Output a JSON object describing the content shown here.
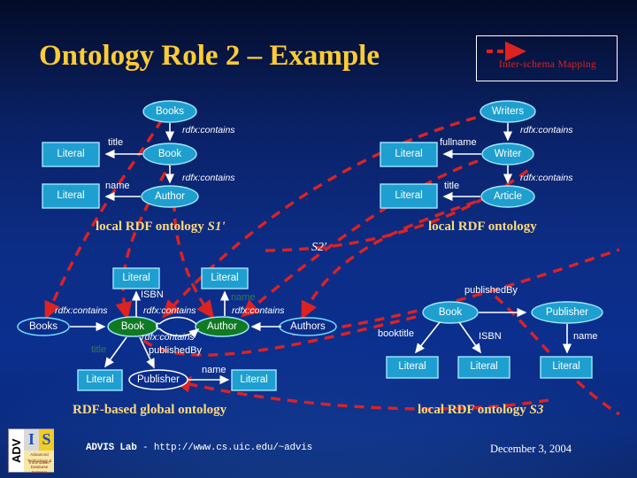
{
  "slide": {
    "title": "Ontology Role 2 – Example",
    "background_top": "#030b28",
    "background_mid": "#0c2d86",
    "title_color": "#ffcc33"
  },
  "legend": {
    "label": "Inter-schema Mapping",
    "arrow_color": "#dd2222",
    "border_color": "#ffffff"
  },
  "captions": {
    "s1": "local RDF ontology ",
    "s1_italic": "S1'",
    "s2_prefix": "local RDF ontology",
    "s2_italic": "S2'",
    "global": "RDF-based global ontology",
    "s3": "local RDF ontology ",
    "s3_italic": "S3"
  },
  "ontology_s1": {
    "nodes": [
      {
        "id": "books",
        "label": "Books",
        "shape": "ellipse",
        "fill": "#1f9fd0"
      },
      {
        "id": "book",
        "label": "Book",
        "shape": "ellipse",
        "fill": "#1f9fd0"
      },
      {
        "id": "author",
        "label": "Author",
        "shape": "ellipse",
        "fill": "#1f9fd0"
      },
      {
        "id": "lit1",
        "label": "Literal",
        "shape": "rect",
        "fill": "#1f9fd0"
      },
      {
        "id": "lit2",
        "label": "Literal",
        "shape": "rect",
        "fill": "#1f9fd0"
      }
    ],
    "edges": [
      {
        "from": "books",
        "to": "book",
        "label": "rdfx:contains",
        "style": "italic"
      },
      {
        "from": "book",
        "to": "lit1",
        "label": "title",
        "style": "plain"
      },
      {
        "from": "book",
        "to": "author",
        "label": "rdfx:contains",
        "style": "italic"
      },
      {
        "from": "author",
        "to": "lit2",
        "label": "name",
        "style": "plain"
      }
    ]
  },
  "ontology_s2": {
    "nodes": [
      {
        "id": "writers",
        "label": "Writers",
        "shape": "ellipse",
        "fill": "#1f9fd0"
      },
      {
        "id": "writer",
        "label": "Writer",
        "shape": "ellipse",
        "fill": "#1f9fd0"
      },
      {
        "id": "article",
        "label": "Article",
        "shape": "ellipse",
        "fill": "#1f9fd0"
      },
      {
        "id": "lit1",
        "label": "Literal",
        "shape": "rect",
        "fill": "#1f9fd0"
      },
      {
        "id": "lit2",
        "label": "Literal",
        "shape": "rect",
        "fill": "#1f9fd0"
      }
    ],
    "edges": [
      {
        "from": "writers",
        "to": "writer",
        "label": "rdfx:contains",
        "style": "italic"
      },
      {
        "from": "writer",
        "to": "lit1",
        "label": "fullname",
        "style": "plain"
      },
      {
        "from": "writer",
        "to": "article",
        "label": "rdfx:contains",
        "style": "italic"
      },
      {
        "from": "article",
        "to": "lit2",
        "label": "title",
        "style": "plain"
      }
    ]
  },
  "ontology_global": {
    "nodes": [
      {
        "id": "books",
        "label": "Books",
        "shape": "ellipse",
        "fill": "#1f9fd0"
      },
      {
        "id": "book",
        "label": "Book",
        "shape": "ellipse",
        "fill": "#0f7a22"
      },
      {
        "id": "author",
        "label": "Author",
        "shape": "ellipse",
        "fill": "#0f7a22"
      },
      {
        "id": "authors",
        "label": "Authors",
        "shape": "ellipse",
        "fill": "#1f9fd0"
      },
      {
        "id": "publisher",
        "label": "Publisher",
        "shape": "ellipse",
        "fill": "#0b2d8c"
      },
      {
        "id": "lit_isbn",
        "label": "Literal",
        "shape": "rect",
        "fill": "#1f9fd0"
      },
      {
        "id": "lit_name",
        "label": "Literal",
        "shape": "rect",
        "fill": "#1f9fd0"
      },
      {
        "id": "lit_title",
        "label": "Literal",
        "shape": "rect",
        "fill": "#1f9fd0"
      },
      {
        "id": "lit_pname",
        "label": "Literal",
        "shape": "rect",
        "fill": "#1f9fd0"
      }
    ],
    "edges": [
      {
        "from": "books",
        "to": "book",
        "label": "rdfx:contains",
        "style": "italic"
      },
      {
        "from": "book",
        "to": "lit_isbn",
        "label": "ISBN",
        "style": "plain"
      },
      {
        "from": "book",
        "to": "author",
        "label": "rdfx:contains",
        "style": "italic"
      },
      {
        "from": "author",
        "to": "book",
        "label": "rdfx:contains",
        "style": "italic"
      },
      {
        "from": "authors",
        "to": "author",
        "label": "rdfx:contains",
        "style": "italic"
      },
      {
        "from": "author",
        "to": "lit_name",
        "label": "name",
        "style": "green"
      },
      {
        "from": "book",
        "to": "lit_title",
        "label": "title",
        "style": "green"
      },
      {
        "from": "book",
        "to": "publisher",
        "label": "publishedBy",
        "style": "plain"
      },
      {
        "from": "publisher",
        "to": "lit_pname",
        "label": "name",
        "style": "plain"
      }
    ]
  },
  "ontology_s3": {
    "nodes": [
      {
        "id": "book",
        "label": "Book",
        "shape": "ellipse",
        "fill": "#1f9fd0"
      },
      {
        "id": "publisher",
        "label": "Publisher",
        "shape": "ellipse",
        "fill": "#1f9fd0"
      },
      {
        "id": "lit_bt",
        "label": "Literal",
        "shape": "rect",
        "fill": "#1f9fd0"
      },
      {
        "id": "lit_isbn",
        "label": "Literal",
        "shape": "rect",
        "fill": "#1f9fd0"
      },
      {
        "id": "lit_name",
        "label": "Literal",
        "shape": "rect",
        "fill": "#1f9fd0"
      }
    ],
    "edges": [
      {
        "from": "book",
        "to": "publisher",
        "label": "publishedBy",
        "style": "plain"
      },
      {
        "from": "book",
        "to": "lit_bt",
        "label": "booktitle",
        "style": "plain"
      },
      {
        "from": "book",
        "to": "lit_isbn",
        "label": "ISBN",
        "style": "plain"
      },
      {
        "from": "publisher",
        "to": "lit_name",
        "label": "name",
        "style": "plain"
      }
    ]
  },
  "footer": {
    "lab": "ADVIS Lab",
    "sep": " - ",
    "url": "http://www.cs.uic.edu/~advis",
    "date": "December 3, 2004",
    "logo": {
      "left_text": "ADV",
      "i": "I",
      "s": "S",
      "sub1": "Advanced Information",
      "sub2": "Technology & Database Systems"
    }
  }
}
